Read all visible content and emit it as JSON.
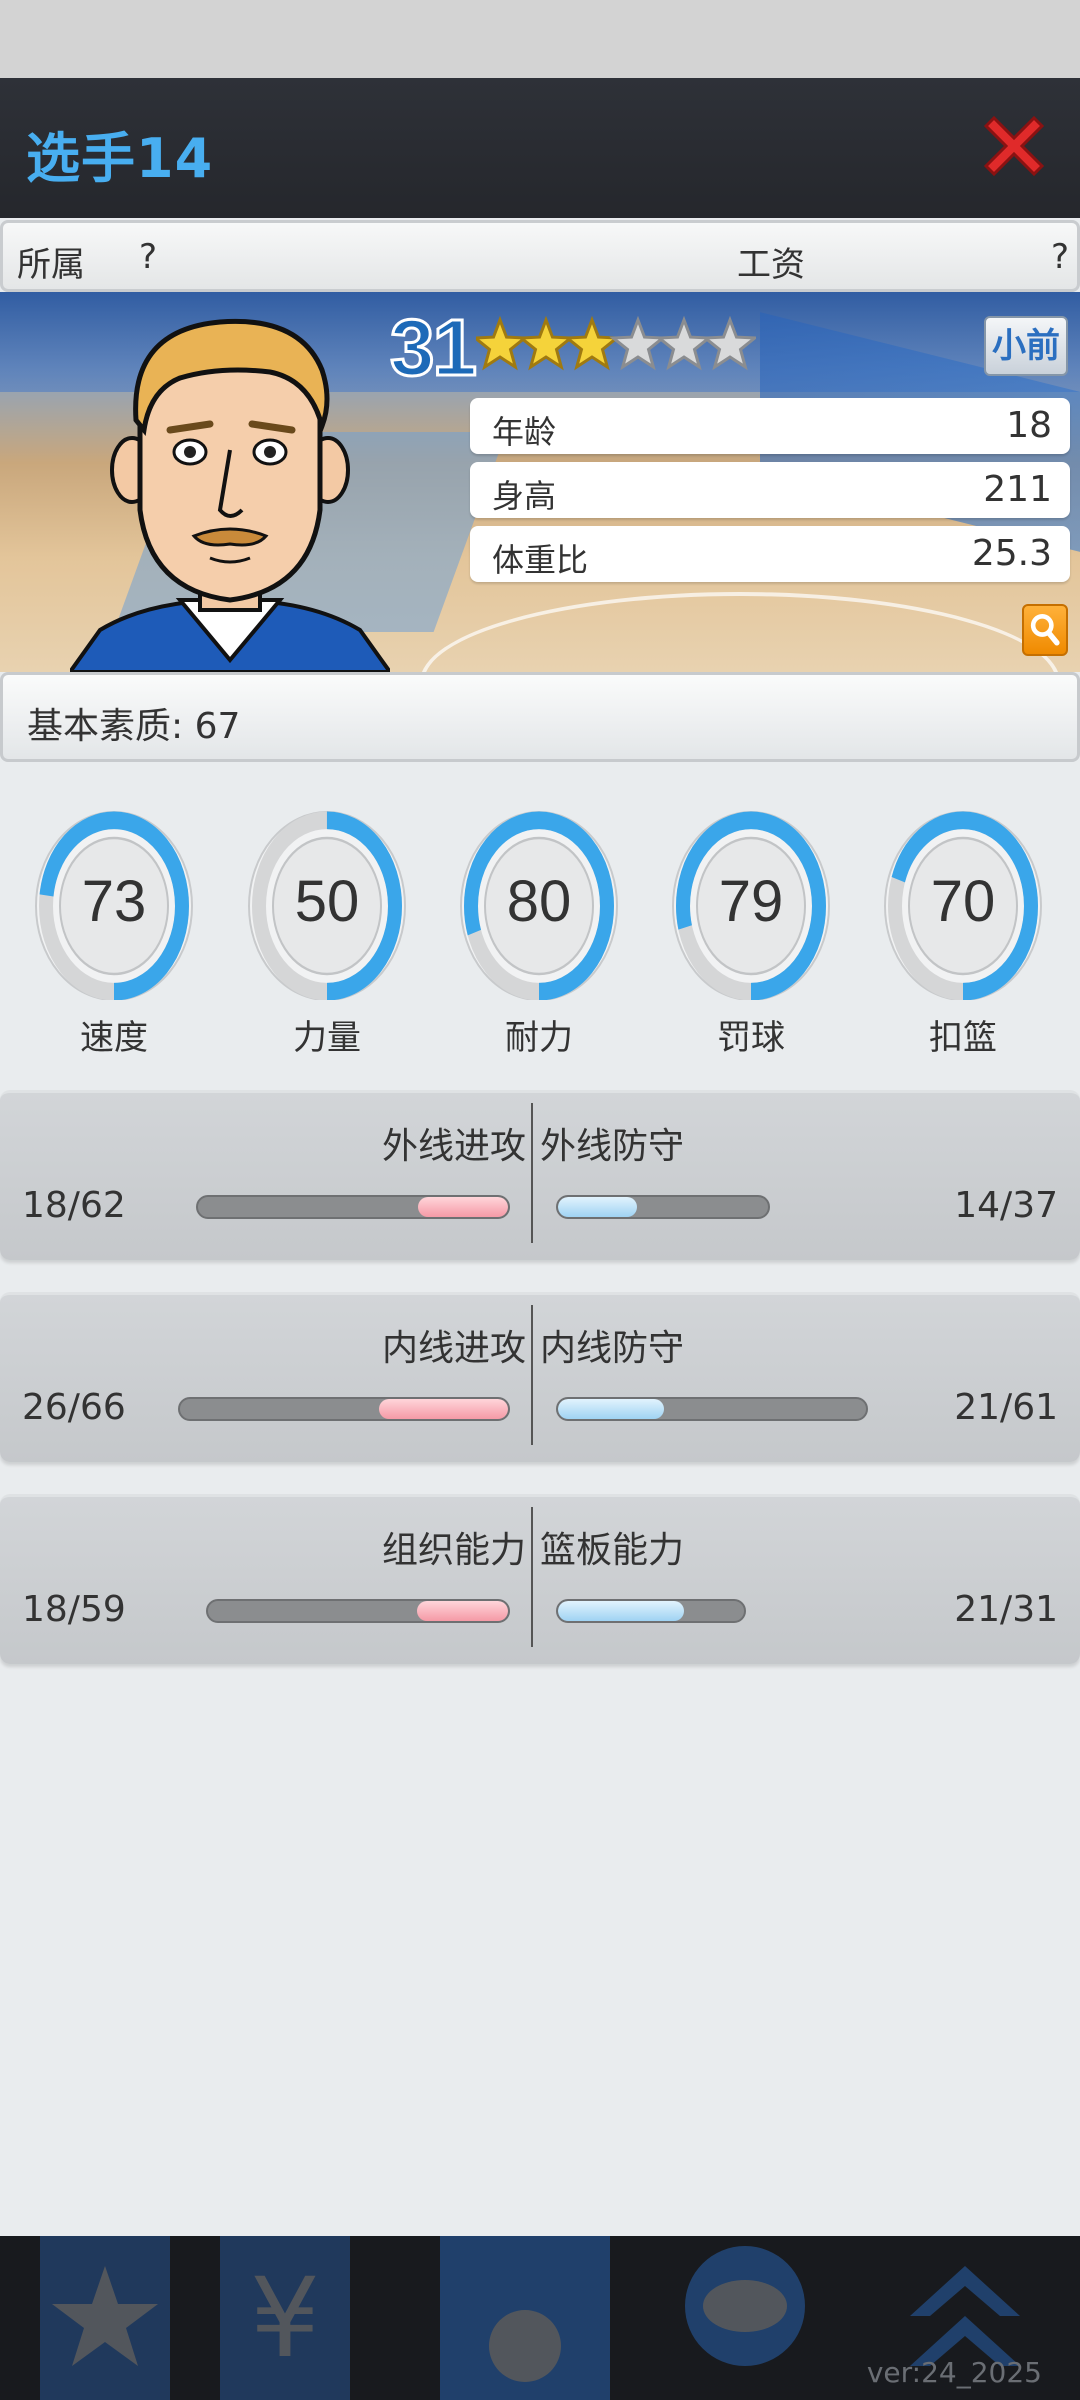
{
  "header": {
    "title": "选手14"
  },
  "info": {
    "team_label": "所属",
    "team_value": "?",
    "salary_label": "工资",
    "salary_value": "?"
  },
  "player": {
    "overall": "31",
    "stars_total": 6,
    "stars_filled": 3,
    "position_button": "小前",
    "attributes": [
      {
        "label": "年龄",
        "value": "18"
      },
      {
        "label": "身高",
        "value": "211"
      },
      {
        "label": "体重比",
        "value": "25.3"
      }
    ]
  },
  "basic": {
    "label": "基本素质: 67"
  },
  "dials": [
    {
      "label": "速度",
      "value": "73",
      "pct": 0.73
    },
    {
      "label": "力量",
      "value": "50",
      "pct": 0.5
    },
    {
      "label": "耐力",
      "value": "80",
      "pct": 0.8
    },
    {
      "label": "罚球",
      "value": "79",
      "pct": 0.79
    },
    {
      "label": "扣篮",
      "value": "70",
      "pct": 0.7
    }
  ],
  "skills": [
    {
      "left_label": "外线进攻",
      "left_value": "18/62",
      "right_label": "外线防守",
      "right_value": "14/37"
    },
    {
      "left_label": "内线进攻",
      "left_value": "26/66",
      "right_label": "内线防守",
      "right_value": "21/61"
    },
    {
      "left_label": "组织能力",
      "left_value": "18/59",
      "right_label": "篮板能力",
      "right_value": "21/31"
    }
  ],
  "footer": {
    "version": "ver:24_2025"
  },
  "colors": {
    "accent_blue": "#48aef0",
    "dial_blue": "#3aa6ea",
    "close_red": "#e02a2a",
    "bar_pink": "#f59aa6",
    "bar_blue": "#9fd3f3"
  }
}
